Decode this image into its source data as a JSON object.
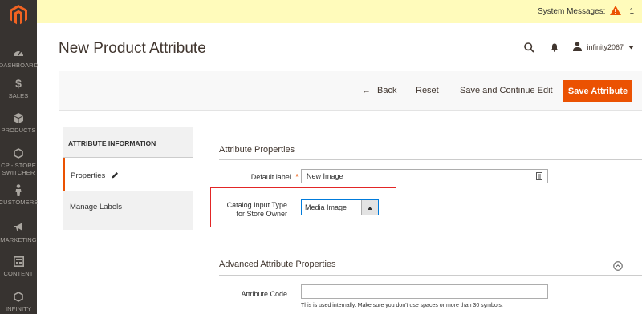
{
  "sidebar": {
    "logo_icon": "magento-logo-icon",
    "items": [
      {
        "label": "DASHBOARD",
        "icon": "speedometer-icon"
      },
      {
        "label": "SALES",
        "icon": "dollar-icon"
      },
      {
        "label": "PRODUCTS",
        "icon": "cube-icon"
      },
      {
        "label": "CP - STORE SWITCHER",
        "icon": "hexagon-icon"
      },
      {
        "label": "CUSTOMERS",
        "icon": "person-icon"
      },
      {
        "label": "MARKETING",
        "icon": "megaphone-icon"
      },
      {
        "label": "CONTENT",
        "icon": "layout-icon"
      },
      {
        "label": "INFINITY",
        "icon": "hexagon-icon"
      }
    ]
  },
  "system_messages": {
    "label": "System Messages:",
    "count": "1"
  },
  "header": {
    "title": "New Product Attribute",
    "username": "infinity2067"
  },
  "toolbar": {
    "back_label": "Back",
    "reset_label": "Reset",
    "save_continue_label": "Save and Continue Edit",
    "save_label": "Save Attribute"
  },
  "tabs": {
    "heading": "ATTRIBUTE INFORMATION",
    "items": [
      "Properties",
      "Manage Labels"
    ]
  },
  "form": {
    "section1_title": "Attribute Properties",
    "default_label": {
      "label": "Default label",
      "value": "New Image"
    },
    "input_type": {
      "label_line1": "Catalog Input Type",
      "label_line2": "for Store Owner",
      "value": "Media Image"
    },
    "section2_title": "Advanced Attribute Properties",
    "attribute_code": {
      "label": "Attribute Code",
      "value": "",
      "hint": "This is used internally. Make sure you don't use spaces or more than 30 symbols."
    }
  },
  "colors": {
    "accent": "#eb5202",
    "sidebar": "#373330",
    "sysbar": "#fffbbb",
    "highlight": "#e22626"
  }
}
